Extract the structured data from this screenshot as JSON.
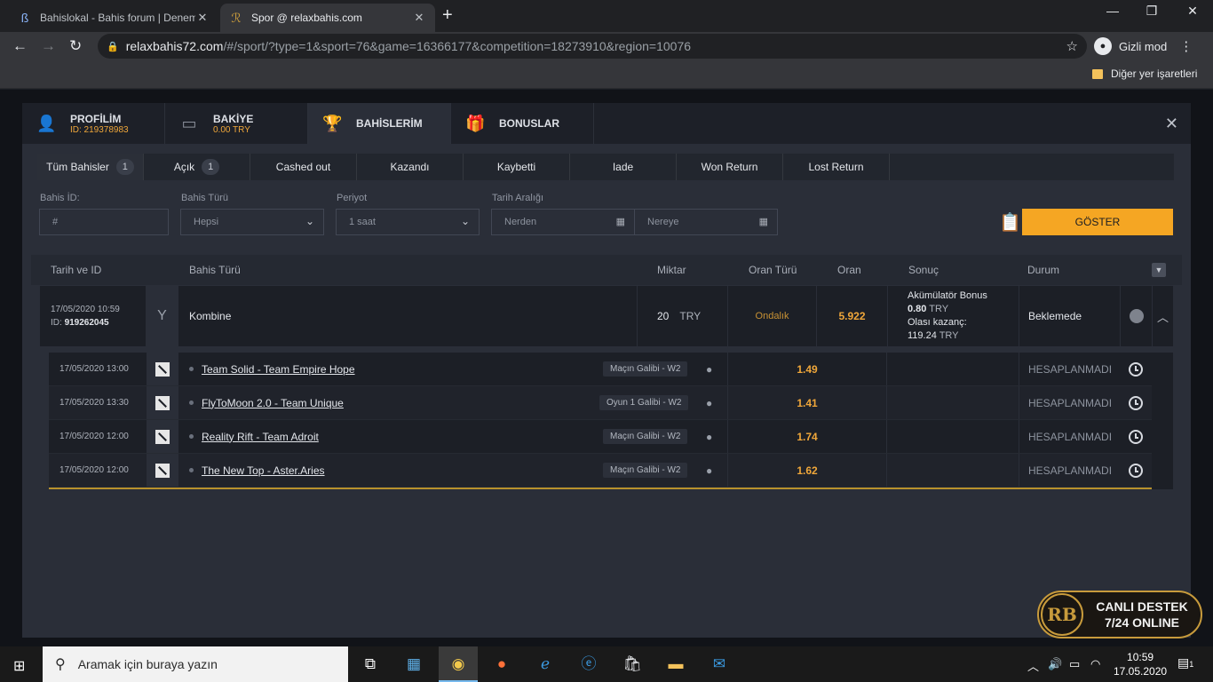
{
  "browser": {
    "tabs": [
      {
        "title": "Bahislokal - Bahis forum | Denem",
        "favicon": "bahislokal-icon"
      },
      {
        "title": "Spor @ relaxbahis.com",
        "favicon": "relaxbahis-icon"
      }
    ],
    "url_host": "relaxbahis72.com",
    "url_path": "/#/sport/?type=1&sport=76&game=16366177&competition=18273910&region=10076",
    "incognito_label": "Gizli mod",
    "bookmarks_label": "Diğer yer işaretleri"
  },
  "modal": {
    "tabs": [
      {
        "label": "PROFİLİM",
        "sub": "ID: 219378983",
        "icon": "user-icon"
      },
      {
        "label": "BAKİYE",
        "sub": "0.00 TRY",
        "icon": "wallet-icon"
      },
      {
        "label": "BAHİSLERİM",
        "sub": "",
        "icon": "trophy-icon"
      },
      {
        "label": "BONUSLAR",
        "sub": "",
        "icon": "gift-icon"
      }
    ],
    "subtabs": [
      {
        "label": "Tüm Bahisler",
        "count": "1"
      },
      {
        "label": "Açık",
        "count": "1"
      },
      {
        "label": "Cashed out",
        "count": ""
      },
      {
        "label": "Kazandı",
        "count": ""
      },
      {
        "label": "Kaybetti",
        "count": ""
      },
      {
        "label": "Iade",
        "count": ""
      },
      {
        "label": "Won Return",
        "count": ""
      },
      {
        "label": "Lost Return",
        "count": ""
      }
    ],
    "filters": {
      "bet_id_label": "Bahis İD:",
      "bet_id_placeholder": "#",
      "bet_type_label": "Bahis Türü",
      "bet_type_value": "Hepsi",
      "period_label": "Periyot",
      "period_value": "1 saat",
      "date_range_label": "Tarih Aralığı",
      "date_from_placeholder": "Nerden",
      "date_to_placeholder": "Nereye",
      "show_button": "GÖSTER"
    },
    "table_headers": {
      "date_id": "Tarih ve ID",
      "bet_type": "Bahis Türü",
      "amount": "Miktar",
      "odds_type": "Oran Türü",
      "odds": "Oran",
      "result": "Sonuç",
      "status": "Durum"
    },
    "main_bet": {
      "date": "17/05/2020 10:59",
      "id_label": "ID:",
      "id": "919262045",
      "type": "Kombine",
      "amount": "20",
      "currency": "TRY",
      "odds_type": "Ondalık",
      "odds": "5.922",
      "bonus_label": "Akümülatör Bonus",
      "bonus_amount": "0.80",
      "bonus_currency": "TRY",
      "potential_label": "Olası kazanç:",
      "potential_amount": "119.24",
      "potential_currency": "TRY",
      "status": "Beklemede"
    },
    "selections": [
      {
        "date": "17/05/2020 13:00",
        "event": "Team Solid - Team Empire Hope",
        "market": "Maçın Galibi - W2",
        "odds": "1.49",
        "status": "HESAPLANMADI"
      },
      {
        "date": "17/05/2020 13:30",
        "event": "FlyToMoon 2.0 - Team Unique",
        "market": "Oyun 1 Galibi - W2",
        "odds": "1.41",
        "status": "HESAPLANMADI"
      },
      {
        "date": "17/05/2020 12:00",
        "event": "Reality Rift - Team Adroit",
        "market": "Maçın Galibi - W2",
        "odds": "1.74",
        "status": "HESAPLANMADI"
      },
      {
        "date": "17/05/2020 12:00",
        "event": "The New Top - Aster.Aries",
        "market": "Maçın Galibi - W2",
        "odds": "1.62",
        "status": "HESAPLANMADI"
      }
    ]
  },
  "live_support": {
    "line1": "CANLI DESTEK",
    "line2": "7/24 ONLINE",
    "logo_text": "RB"
  },
  "taskbar": {
    "search_placeholder": "Aramak için buraya yazın",
    "time": "10:59",
    "date": "17.05.2020",
    "notifications": "1"
  },
  "colors": {
    "accent": "#f5a623",
    "odds": "#f0a73a",
    "gold_line": "#b8912c"
  }
}
